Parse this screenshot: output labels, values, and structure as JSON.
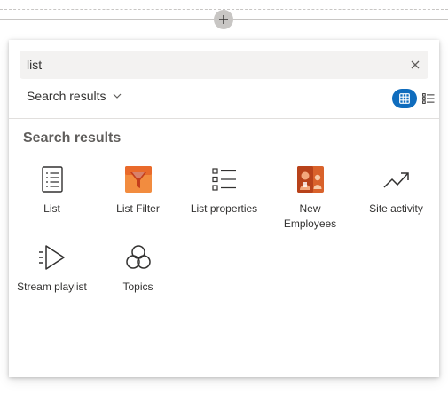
{
  "canvas": {
    "add_section_icon": "plus-icon"
  },
  "toolbox": {
    "search": {
      "value": "list",
      "placeholder": "",
      "clear_icon": "close-icon"
    },
    "filter_dropdown": {
      "label": "Search results",
      "icon": "chevron-down-icon"
    },
    "view_toggle": {
      "grid_icon": "grid-view-icon",
      "list_icon": "list-view-icon",
      "selected": "grid",
      "accent_color": "#0f6cbd"
    },
    "section_heading": "Search results",
    "web_parts": [
      {
        "label": "List",
        "icon": "list-document-icon"
      },
      {
        "label": "List Filter",
        "icon": "funnel-filter-icon"
      },
      {
        "label": "List properties",
        "icon": "list-properties-icon"
      },
      {
        "label": "New\nEmployees",
        "icon": "new-employees-icon"
      },
      {
        "label": "Site activity",
        "icon": "trend-arrow-icon"
      },
      {
        "label": "Stream playlist",
        "icon": "stream-play-icon"
      },
      {
        "label": "Topics",
        "icon": "topics-icon"
      }
    ]
  }
}
